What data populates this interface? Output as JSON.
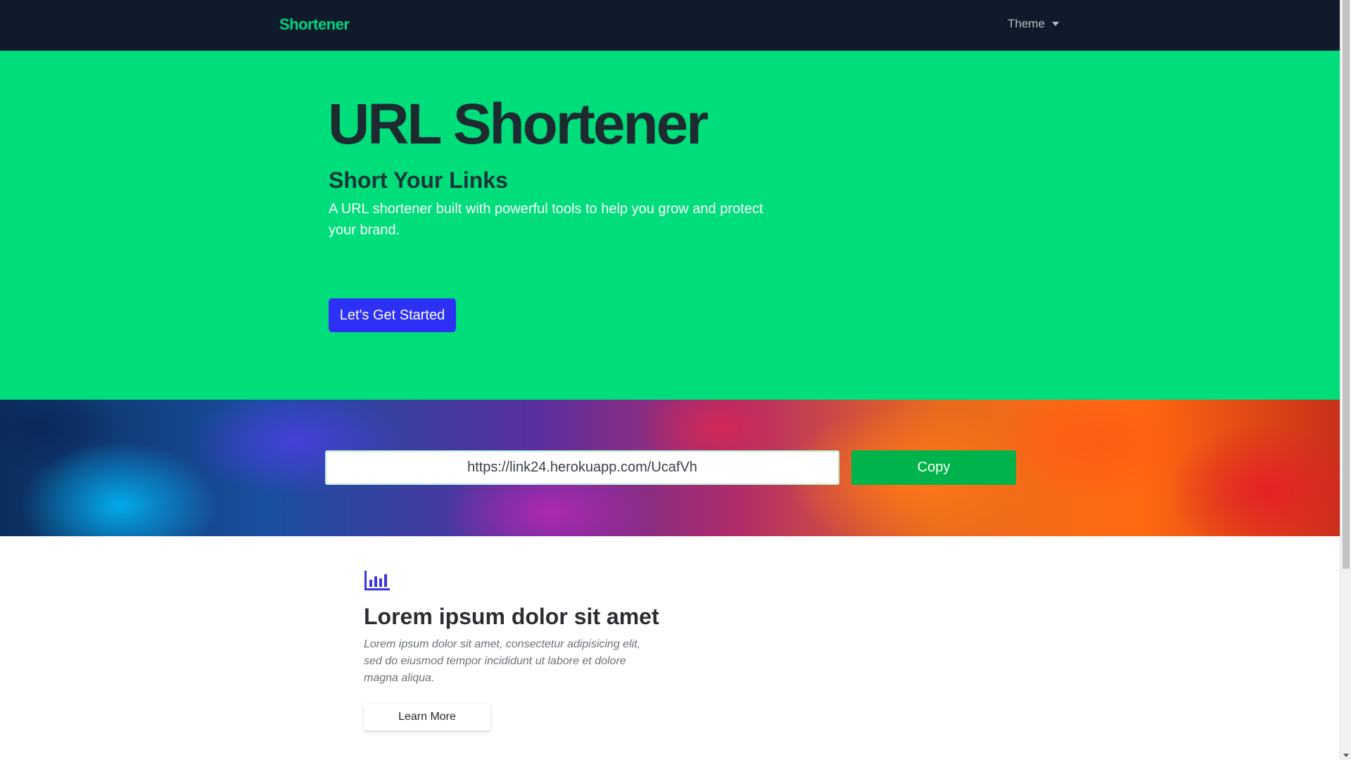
{
  "navbar": {
    "brand": "Shortener",
    "theme_label": "Theme"
  },
  "hero": {
    "title": "URL Shortener",
    "subtitle": "Short Your Links",
    "description": "A URL shortener built with powerful tools to help you grow and protect your brand.",
    "cta_label": "Let's Get Started"
  },
  "shortener": {
    "url_value": "https://link24.herokuapp.com/UcafVh",
    "copy_label": "Copy"
  },
  "feature": {
    "icon": "bar-chart-icon",
    "title": "Lorem ipsum dolor sit amet",
    "text": "Lorem ipsum dolor sit amet, consectetur adipisicing elit, sed do eiusmod tempor incididunt ut labore et dolore magna aliqua.",
    "button_label": "Learn More"
  },
  "colors": {
    "navbar_bg": "#0f1b2b",
    "brand": "#00d47e",
    "hero_bg": "#00dd7b",
    "cta_bg": "#2d30f5",
    "copy_bg": "#00b34a",
    "icon": "#3b35e6"
  }
}
